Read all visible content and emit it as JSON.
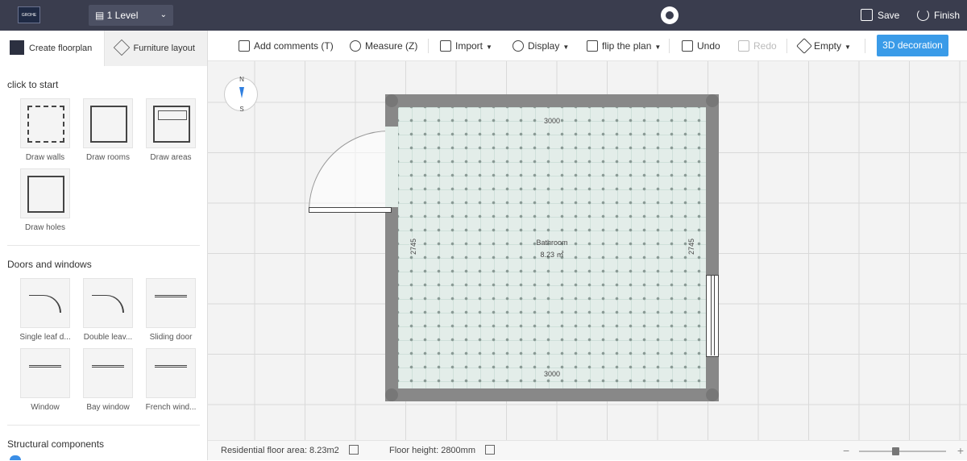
{
  "topbar": {
    "logo_text": "GROHE",
    "level_label": "1 Level",
    "save_label": "Save",
    "finish_label": "Finish"
  },
  "sidebar": {
    "tabs": [
      {
        "label": "Create floorplan",
        "active": true
      },
      {
        "label": "Furniture layout",
        "active": false
      }
    ],
    "start_title": "click to start",
    "start_tools": [
      {
        "label": "Draw walls",
        "icon": "draw-walls-icon"
      },
      {
        "label": "Draw rooms",
        "icon": "draw-rooms-icon"
      },
      {
        "label": "Draw areas",
        "icon": "draw-areas-icon"
      },
      {
        "label": "Draw holes",
        "icon": "draw-holes-icon"
      }
    ],
    "doors_title": "Doors and windows",
    "door_tools": [
      {
        "label": "Single leaf d...",
        "icon": "single-leaf-door-icon"
      },
      {
        "label": "Double leav...",
        "icon": "double-leaf-door-icon"
      },
      {
        "label": "Sliding door",
        "icon": "sliding-door-icon"
      },
      {
        "label": "Window",
        "icon": "window-icon"
      },
      {
        "label": "Bay window",
        "icon": "bay-window-icon"
      },
      {
        "label": "French wind...",
        "icon": "french-window-icon"
      }
    ],
    "structural_title": "Structural components"
  },
  "toolbar": {
    "add_comments": "Add comments (T)",
    "measure": "Measure (Z)",
    "import": "Import",
    "display": "Display",
    "flip": "flip the plan",
    "undo": "Undo",
    "redo": "Redo",
    "empty": "Empty",
    "decoration": "3D decoration"
  },
  "canvas": {
    "compass_n": "N",
    "compass_s": "S",
    "room_name": "Bathroom",
    "room_area": "8.23 ㎡",
    "dim_top": "3000",
    "dim_bottom": "3000",
    "dim_left": "2745",
    "dim_right": "2745"
  },
  "status": {
    "floor_area": "Residential floor area:  8.23m2",
    "floor_height": "Floor height:  2800mm",
    "zoom_minus": "−",
    "zoom_plus": "+",
    "zoom_level": 0.42
  },
  "colors": {
    "topbar": "#3a3d4e",
    "accent": "#3a9be8",
    "wall": "#888888",
    "floor": "#e3ede9"
  }
}
